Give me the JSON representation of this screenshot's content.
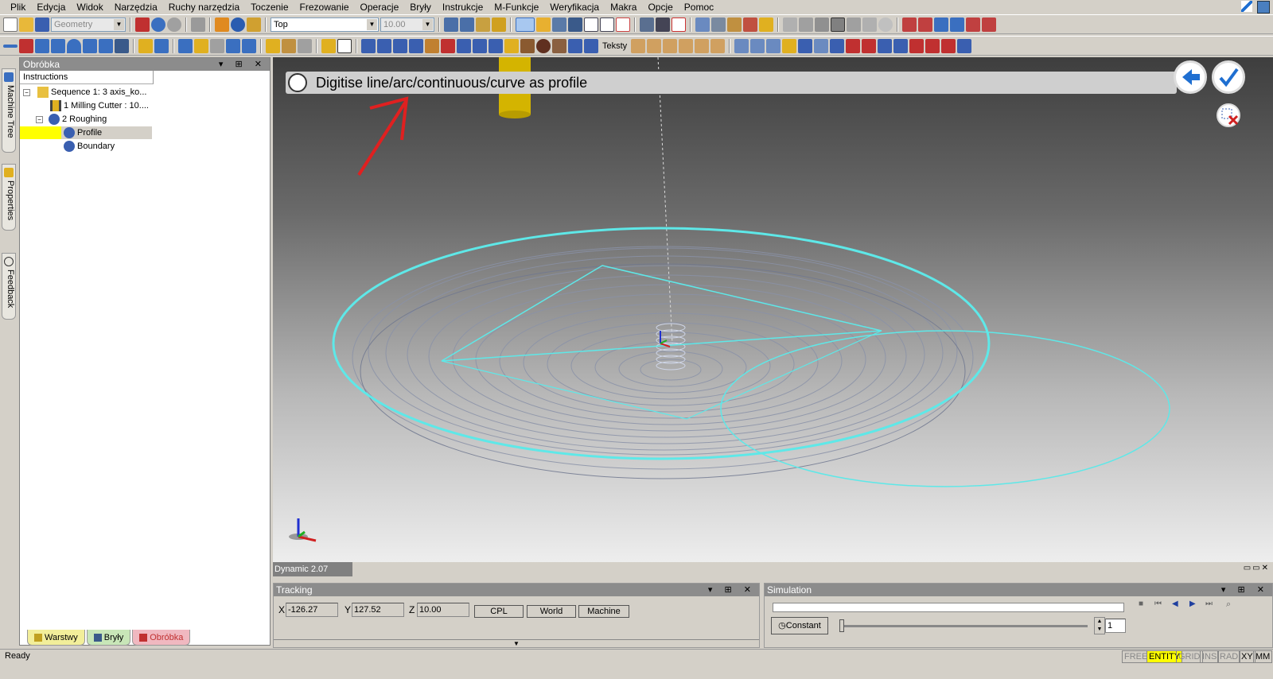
{
  "menu": [
    "Plik",
    "Edycja",
    "Widok",
    "Narzędzia",
    "Ruchy narzędzia",
    "Toczenie",
    "Frezowanie",
    "Operacje",
    "Bryły",
    "Instrukcje",
    "M-Funkcje",
    "Weryfikacja",
    "Makra",
    "Opcje",
    "Pomoc"
  ],
  "toolbar": {
    "geometry_combo": "Geometry",
    "view_combo": "Top",
    "value_combo": "10.00",
    "teksty": "Teksty"
  },
  "side_tabs": [
    "Machine Tree",
    "Properties",
    "Feedback"
  ],
  "panel": {
    "title": "Obróbka",
    "column": "Instructions",
    "tree": [
      {
        "label": "Sequence 1: 3 axis_ko..."
      },
      {
        "label": "1 Milling Cutter : 10...."
      },
      {
        "label": "2 Roughing"
      },
      {
        "label": "Profile"
      },
      {
        "label": "Boundary"
      }
    ],
    "tabs": [
      "Warstwy",
      "Bryły",
      "Obróbka"
    ]
  },
  "viewport": {
    "prompt": "Digitise line/arc/continuous/curve as profile",
    "dynamic": "Dynamic 2.07"
  },
  "tracking": {
    "title": "Tracking",
    "x_label": "X",
    "x": "-126.27",
    "y_label": "Y",
    "y": "127.52",
    "z_label": "Z",
    "z": "10.00",
    "buttons": [
      "CPL",
      "World",
      "Machine"
    ]
  },
  "simulation": {
    "title": "Simulation",
    "mode": "Constant",
    "step": "1"
  },
  "status": {
    "text": "Ready",
    "flags": [
      "FREE",
      "ENTITY",
      "GRID",
      "INS",
      "RAD",
      "XY",
      "MM"
    ],
    "active_flag": "ENTITY"
  },
  "colors": {
    "accent_cyan": "#5ee8e8",
    "highlight": "#ffff00",
    "arrow_red": "#e02020",
    "nav_blue": "#1f6fd1"
  }
}
